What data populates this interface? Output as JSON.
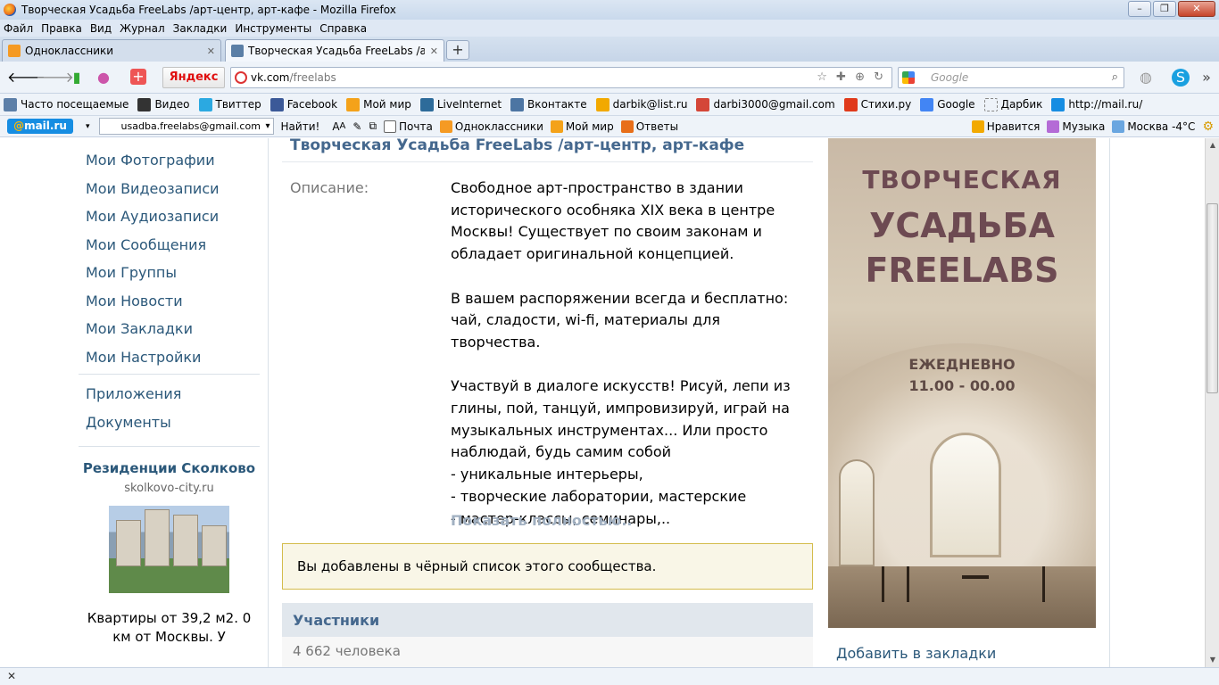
{
  "window": {
    "title": "Творческая Усадьба FreeLabs /арт-центр, арт-кафе - Mozilla Firefox",
    "min": "–",
    "max": "❐",
    "close": "✕"
  },
  "menu": [
    "Файл",
    "Правка",
    "Вид",
    "Журнал",
    "Закладки",
    "Инструменты",
    "Справка"
  ],
  "tabs": [
    {
      "label": "Одноклассники",
      "close": "✕",
      "color": "#f59a23"
    },
    {
      "label": "Творческая Усадьба FreeLabs /арт-ц...",
      "close": "✕",
      "color": "#5b7fa6"
    }
  ],
  "new_tab": "+",
  "nav": {
    "back": "🡐",
    "forward": "🡒",
    "yandex": "Яндекс",
    "url_host": "vk.com",
    "url_path": "/freelabs",
    "url_right": "☆ ✚ ⊕ ↻",
    "search_placeholder": "Google",
    "search_icon": "⌕"
  },
  "bookmarks": [
    {
      "label": "Часто посещаемые",
      "color": "#5c7fa8"
    },
    {
      "label": "Видео",
      "color": "#333333"
    },
    {
      "label": "Твиттер",
      "color": "#2ba9e1"
    },
    {
      "label": "Facebook",
      "color": "#3b5998"
    },
    {
      "label": "Мой мир",
      "color": "#f4a21a"
    },
    {
      "label": "LiveInternet",
      "color": "#2d6b9a"
    },
    {
      "label": "Вконтакте",
      "color": "#4c75a3"
    },
    {
      "label": "darbik@list.ru",
      "color": "#f2a900"
    },
    {
      "label": "darbi3000@gmail.com",
      "color": "#d44638"
    },
    {
      "label": "Стихи.ру",
      "color": "#e03a1b"
    },
    {
      "label": "Google",
      "color": "#4285f4"
    },
    {
      "label": "Дарбик",
      "color": "#ffffff"
    },
    {
      "label": "http://mail.ru/",
      "color": "#168de2"
    }
  ],
  "mailbar": {
    "logo": "mail.ru",
    "account": "usadba.freelabs@gmail.com",
    "find": "Найти!",
    "items": [
      {
        "label": "Почта",
        "color": "#168de2"
      },
      {
        "label": "Одноклассники",
        "color": "#f59a23"
      },
      {
        "label": "Мой мир",
        "color": "#f4a21a"
      },
      {
        "label": "Ответы",
        "color": "#e86f1a"
      }
    ],
    "right_items": [
      {
        "label": "Нравится",
        "color": "#f2a900"
      },
      {
        "label": "Музыка",
        "color": "#b46bd6"
      },
      {
        "label": "Москва -4°С",
        "color": "#6aa6e0"
      }
    ]
  },
  "left_nav": {
    "items": [
      "Мои Фотографии",
      "Мои Видеозаписи",
      "Мои Аудиозаписи",
      "Мои Сообщения",
      "Мои Группы",
      "Мои Новости",
      "Мои Закладки",
      "Мои Настройки"
    ],
    "extra": [
      "Приложения",
      "Документы"
    ]
  },
  "ad": {
    "title": "Резиденции Сколково",
    "domain": "skolkovo-city.ru",
    "text": "Квартиры от 39,2 м2. 0 км от Москвы. У"
  },
  "group": {
    "title": "Творческая Усадьба FreeLabs /арт-центр, арт-кафе",
    "desc_label": "Описание:",
    "desc_p1": "Свободное арт-пространство в здании исторического особняка XIX века в центре Москвы! Существует по своим законам и обладает оригинальной концепцией.",
    "desc_p2": "В вашем распоряжении всегда и бесплатно: чай, сладости, wi-fi, материалы для творчества.",
    "desc_p3": "Участвуй в диалоге искусств! Рисуй, лепи из глины, пой, танцуй, импровизируй, играй на музыкальных инструментах... Или просто наблюдай, будь самим собой",
    "list": [
      "- уникальные интерьеры,",
      "- творческие лаборатории, мастерские",
      "- мастер-классы, семинары,.."
    ],
    "show_more": "Показать полностью..",
    "notice": "Вы добавлены в чёрный список этого сообщества.",
    "members_title": "Участники",
    "members_count": "4 662 человека"
  },
  "poster": {
    "line1": "ТВОРЧЕСКАЯ",
    "line2": "УСАДЬБА",
    "line3": "FREELABS",
    "line4": "ЕЖЕДНЕВНО",
    "line5": "11.00 - 00.00"
  },
  "add_bookmark": "Добавить в закладки",
  "findbar_close": "✕"
}
